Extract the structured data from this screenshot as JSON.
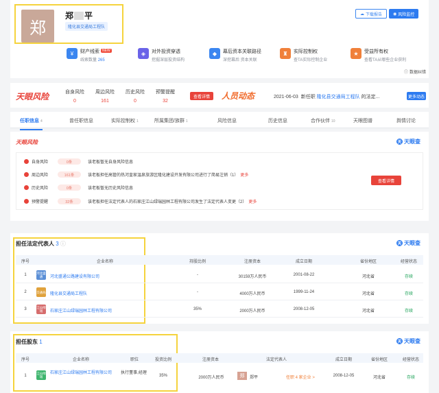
{
  "header": {
    "avatar_char": "郑",
    "name_first": "郑",
    "name_last": "平",
    "tag": "隆化县交通局工程队",
    "btn_download": "下载报告",
    "btn_monitor": "风险监控",
    "features": [
      {
        "icon": "wallet-icon",
        "color": "#3b86f0",
        "title": "财产线索",
        "badge": "NEW",
        "sub_prefix": "线索数量",
        "sub_value": "265"
      },
      {
        "icon": "penetration-icon",
        "color": "#6a63e8",
        "title": "对外投资穿透",
        "sub_prefix": "挖掘深层投资结构",
        "sub_value": ""
      },
      {
        "icon": "capital-icon",
        "color": "#3b86f0",
        "title": "幕后资本关联路径",
        "sub_prefix": "深挖幕后 资本关联",
        "sub_value": ""
      },
      {
        "icon": "control-icon",
        "color": "#f0803a",
        "title": "实际控制权",
        "sub_prefix": "查TA实际控制企业",
        "sub_value": ""
      },
      {
        "icon": "beneficiary-icon",
        "color": "#f0803a",
        "title": "受益所有权",
        "sub_prefix": "查看TA从哪些企业获利",
        "sub_value": ""
      }
    ],
    "data_map": "数据纠错"
  },
  "risk_bar": {
    "logo": "天眼风险",
    "stats": [
      {
        "label": "自身风险",
        "value": "0"
      },
      {
        "label": "周边风险",
        "value": "161"
      },
      {
        "label": "历史风险",
        "value": "0"
      },
      {
        "label": "预警提醒",
        "value": "32"
      }
    ],
    "detail_btn": "查看详情",
    "dynamic_logo": "人员动态",
    "dynamic_date": "2021-06-03",
    "dynamic_prefix": "新任职",
    "dynamic_company": "隆化县交通局工程队",
    "dynamic_suffix": "的法定...",
    "more_btn": "更多动态"
  },
  "tabs": [
    {
      "label": "任职信息",
      "count": "4",
      "active": true
    },
    {
      "label": "曾任职信息",
      "count": ""
    },
    {
      "label": "实际控制权",
      "count": "1"
    },
    {
      "label": "所属集团/族群",
      "count": "1"
    },
    {
      "label": "风险信息",
      "count": ""
    },
    {
      "label": "历史信息",
      "count": ""
    },
    {
      "label": "合作伙伴",
      "count": "10"
    },
    {
      "label": "天眼图谱",
      "count": ""
    },
    {
      "label": "舆情讨论",
      "count": ""
    }
  ],
  "risk_section": {
    "title": "天眼风险",
    "brand": "天眼查",
    "rows": [
      {
        "label": "自身风险",
        "pill": "0条",
        "text": "该老板暂无自身风险信息",
        "more": ""
      },
      {
        "label": "周边风险",
        "pill": "161条",
        "text": "该老板担任高管的热河皇家温泉旅游区隆化建设开发有限公司进行了简易注销（1）",
        "more": "更多"
      },
      {
        "label": "历史风险",
        "pill": "0条",
        "text": "该老板暂无历史风险信息",
        "more": ""
      },
      {
        "label": "预警提醒",
        "pill": "32条",
        "text": "该老板担任法定代表人的石家庄江山绿瑞园林工程有限公司发生了法定代表人变更（2）",
        "more": "更多"
      }
    ],
    "query_btn": "查看详情"
  },
  "legal_rep": {
    "title": "担任法定代表人",
    "count": "3",
    "brand": "天眼查",
    "columns": [
      "序号",
      "企业名称",
      "持股比例",
      "注册资本",
      "成立日期",
      "省份地区",
      "经营状态"
    ],
    "rows": [
      {
        "no": "1",
        "logo": "河北盛通",
        "logo_color": "#5b8fd6",
        "name": "河北盛通公路建设有限公司",
        "ratio": "-",
        "capital": "30159万人民币",
        "date": "2001-08-22",
        "region": "河北省",
        "status": "存续"
      },
      {
        "no": "2",
        "logo": "交通局",
        "logo_color": "#e0a23c",
        "name": "隆化县交通局工程队",
        "ratio": "-",
        "capital": "4000万人民币",
        "date": "1999-11-24",
        "region": "河北省",
        "status": "存续"
      },
      {
        "no": "3",
        "logo": "江山绿瑞",
        "logo_color": "#d66d6d",
        "name": "石家庄江山绿瑞园林工程有限公司",
        "ratio": "35%",
        "capital": "2000万人民币",
        "date": "2008-12-05",
        "region": "河北省",
        "status": "存续"
      }
    ]
  },
  "shareholder": {
    "title": "担任股东",
    "count": "1",
    "brand": "天眼查",
    "columns": [
      "序号",
      "企业名称",
      "职位",
      "投资比例",
      "注册资本",
      "法定代表人",
      "成立日期",
      "省份地区",
      "经营状态"
    ],
    "rows": [
      {
        "no": "1",
        "logo": "江山绿瑞",
        "logo_color": "#3fb56e",
        "name": "石家庄江山绿瑞园林工程有限公司",
        "position": "执行董事,经理",
        "ratio": "35%",
        "capital": "2000万人民币",
        "rep_avatar": "郑",
        "rep_name": "郑平",
        "rep_link": "任职 4 家企业 >",
        "date": "2008-12-05",
        "region": "河北省",
        "status": "存续"
      }
    ]
  }
}
